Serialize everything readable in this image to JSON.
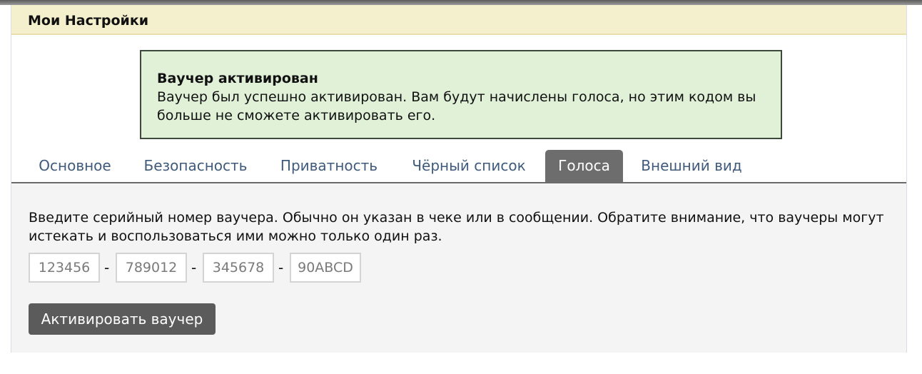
{
  "panel": {
    "title": "Мои Настройки"
  },
  "notice": {
    "title": "Ваучер активирован",
    "message": "Ваучер был успешно активирован. Вам будут начислены голоса, но этим кодом вы больше не сможете активировать его."
  },
  "tabs": [
    {
      "label": "Основное",
      "active": false
    },
    {
      "label": "Безопасность",
      "active": false
    },
    {
      "label": "Приватность",
      "active": false
    },
    {
      "label": "Чёрный список",
      "active": false
    },
    {
      "label": "Голоса",
      "active": true
    },
    {
      "label": "Внешний вид",
      "active": false
    }
  ],
  "voucher": {
    "instructions": "Введите серийный номер ваучера. Обычно он указан в чеке или в сообщении. Обратите внимание, что ваучеры могут истекать и воспользоваться ими можно только один раз.",
    "segments": [
      {
        "placeholder": "123456",
        "value": ""
      },
      {
        "placeholder": "789012",
        "value": ""
      },
      {
        "placeholder": "345678",
        "value": ""
      },
      {
        "placeholder": "90ABCD",
        "value": ""
      }
    ],
    "separator": "-",
    "activate_label": "Активировать ваучер"
  },
  "colors": {
    "header_bg": "#f4efcc",
    "notice_bg": "#e1f1d8",
    "tab_text": "#3f5a7a",
    "tab_active_bg": "#6d6d6d",
    "button_bg": "#5b5b5b"
  }
}
